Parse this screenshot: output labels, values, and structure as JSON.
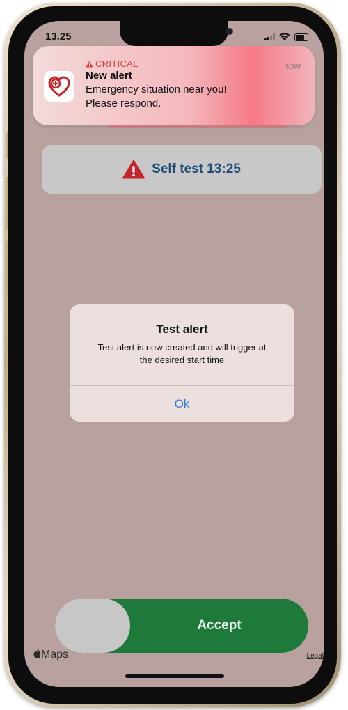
{
  "status_bar": {
    "time": "13.25"
  },
  "notification": {
    "critical_label": "CRITICAL",
    "time": "now",
    "title": "New alert",
    "body_line1": "Emergency situation near you!",
    "body_line2": "Please respond.",
    "app_icon": "heart-shield-icon",
    "accent_color": "#e23a35"
  },
  "self_test": {
    "label": "Self test 13:25",
    "icon": "warning-triangle-icon"
  },
  "dialog": {
    "title": "Test alert",
    "message": "Test alert is now created and will trigger at the desired start time",
    "ok_label": "Ok"
  },
  "accept_slider": {
    "label": "Accept",
    "color": "#1e7a3b"
  },
  "map": {
    "logo_text": "Maps",
    "legal_label": "Legal"
  }
}
